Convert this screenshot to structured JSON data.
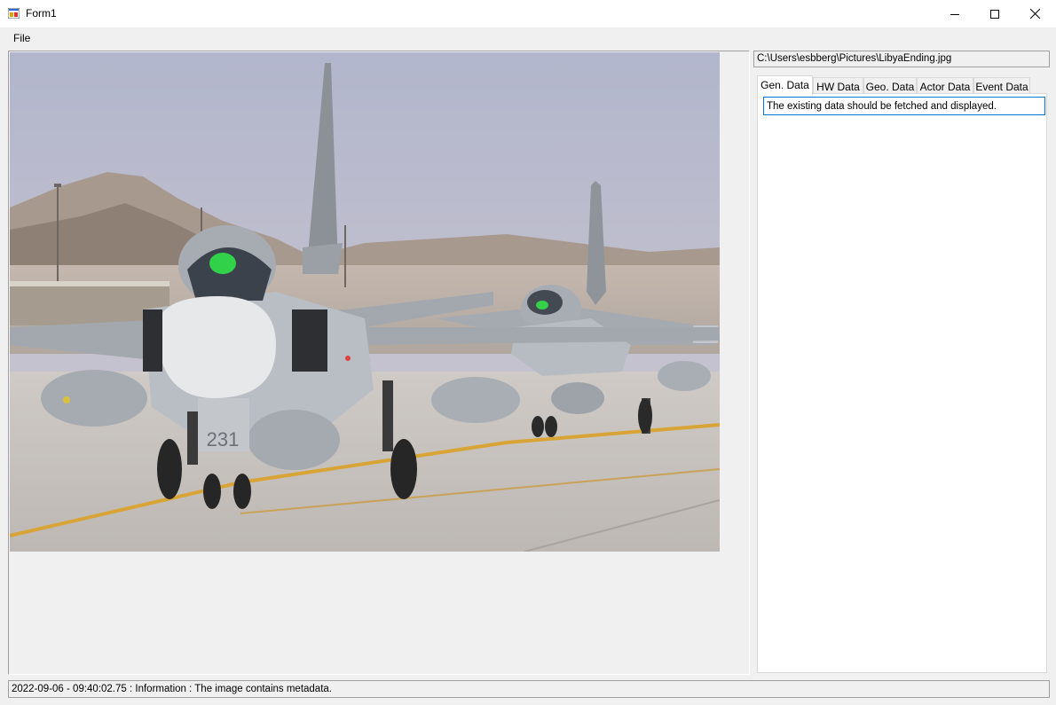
{
  "window": {
    "title": "Form1",
    "controls": [
      "minimize-icon",
      "maximize-icon",
      "close-icon"
    ]
  },
  "menu": {
    "items": [
      {
        "label": "File"
      }
    ]
  },
  "file_path": "C:\\Users\\esbberg\\Pictures\\LibyaEnding.jpg",
  "tabs": [
    {
      "label": "Gen. Data",
      "active": true
    },
    {
      "label": "HW Data",
      "active": false
    },
    {
      "label": "Geo. Data",
      "active": false
    },
    {
      "label": "Actor Data",
      "active": false
    },
    {
      "label": "Event Data",
      "active": false
    }
  ],
  "gen_data": {
    "text_value": "The existing data should be fetched and displayed."
  },
  "photo": {
    "tail_number": "231"
  },
  "status": {
    "message": "2022-09-06 - 09:40:02.75 : Information : The image contains metadata."
  },
  "colors": {
    "accent": "#0078d7",
    "window_bg": "#f0f0f0",
    "sky": "#b9bdd3"
  }
}
